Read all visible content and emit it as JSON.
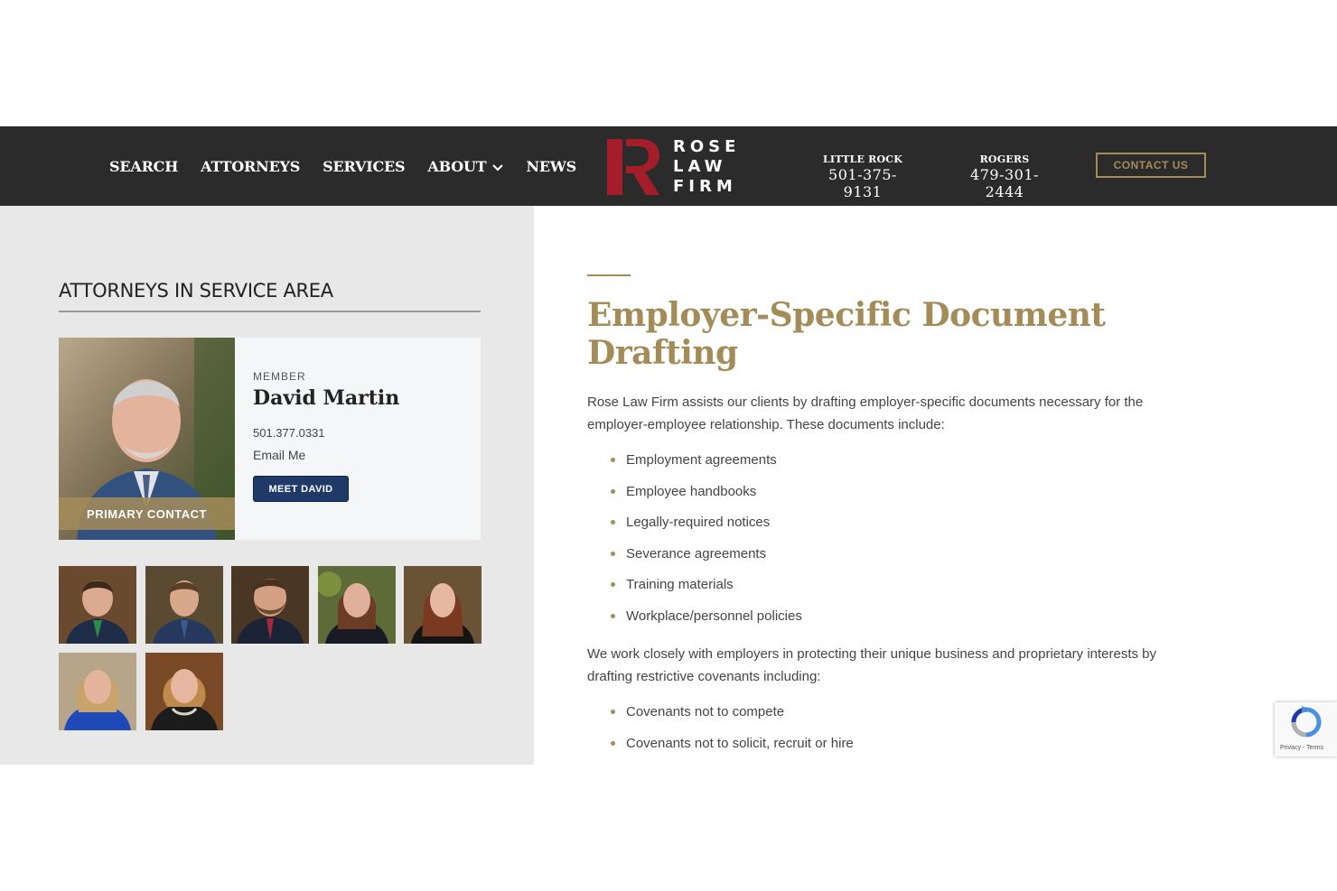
{
  "header": {
    "nav": [
      {
        "label": "SEARCH"
      },
      {
        "label": "ATTORNEYS"
      },
      {
        "label": "SERVICES"
      },
      {
        "label": "ABOUT"
      },
      {
        "label": "NEWS"
      }
    ],
    "logo_lines": [
      "ROSE",
      "LAW",
      "FIRM"
    ],
    "phones": [
      {
        "city": "LITTLE ROCK",
        "number": "501-375-9131"
      },
      {
        "city": "ROGERS",
        "number": "479-301-2444"
      }
    ],
    "contact_label": "CONTACT US"
  },
  "sidebar": {
    "title": "ATTORNEYS IN SERVICE AREA",
    "primary": {
      "role": "MEMBER",
      "name": "David Martin",
      "phone": "501.377.0331",
      "email_label": "Email Me",
      "button_label": "MEET DAVID",
      "badge": "PRIMARY CONTACT"
    }
  },
  "content": {
    "title": "Employer-Specific Document Drafting",
    "intro": "Rose Law Firm assists our clients by drafting employer-specific documents necessary for the employer-employee relationship. These documents include:",
    "list1": [
      "Employment agreements",
      "Employee handbooks",
      "Legally-required notices",
      "Severance agreements",
      "Training materials",
      "Workplace/personnel policies"
    ],
    "para2": "We work closely with employers in protecting their unique business and proprietary interests by drafting restrictive covenants including:",
    "list2": [
      "Covenants not to compete",
      "Covenants not to solicit, recruit or hire"
    ]
  },
  "recaptcha": {
    "text": "Privacy - Terms"
  },
  "colors": {
    "gold": "#a48c59",
    "header_bg": "#2b2b2b",
    "navy": "#1f3a68",
    "brand_red": "#a51c2b"
  }
}
